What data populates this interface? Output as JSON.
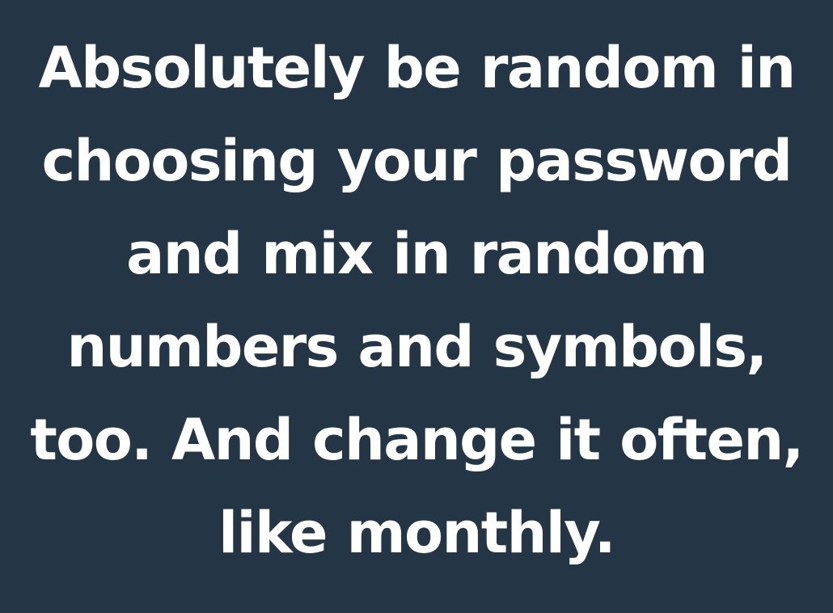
{
  "quote": {
    "lines": [
      "Absolutely be random in",
      "choosing your password",
      "and mix in random",
      "numbers and symbols,",
      "too. And change it often,",
      "like monthly."
    ]
  },
  "colors": {
    "background": "#243645",
    "text": "#ffffff"
  }
}
